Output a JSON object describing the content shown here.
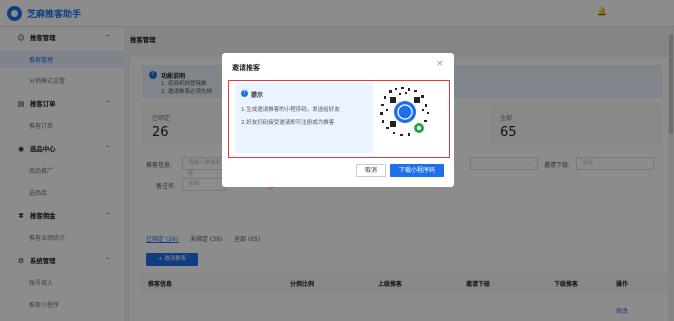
{
  "app": {
    "title": "芝麻推客助手"
  },
  "sidebar": {
    "groups": [
      {
        "icon": "user-group-icon",
        "label": "推客管理",
        "items": [
          "推客管理",
          "分销模式设置"
        ]
      },
      {
        "icon": "list-icon",
        "label": "推客订单",
        "items": [
          "推客订单"
        ]
      },
      {
        "icon": "goods-icon",
        "label": "选品中心",
        "items": [
          "商品推广",
          "选品库"
        ]
      },
      {
        "icon": "money-icon",
        "label": "推客佣金",
        "items": [
          "推客业绩统计"
        ]
      },
      {
        "icon": "settings-icon",
        "label": "系统管理",
        "items": [
          "账号接入",
          "推客小程序"
        ]
      }
    ]
  },
  "main": {
    "breadcrumb": "推客管理",
    "notice": {
      "title": "功能说明",
      "lines": [
        "1. 招商机构管辖推",
        "2. 邀请推客必须先绑"
      ]
    },
    "stats": [
      {
        "label": "已绑定",
        "value": "26"
      },
      {
        "label": "全部",
        "value": "65"
      }
    ],
    "filters": {
      "info_label": "推客信息:",
      "info_placeholder": "请输入推客昵称",
      "name_label": "备注名:",
      "name_placeholder": "全部",
      "downline_label": "邀请下级:",
      "downline_value": "全部"
    },
    "tabs": [
      "已绑定 (26)",
      "未绑定 (39)",
      "全部 (65)"
    ],
    "invite_button": "+ 邀请推客",
    "table_headers": [
      "推客信息",
      "分佣比例",
      "上级推客",
      "邀请下级",
      "下级推客",
      "操作"
    ],
    "edit_link": "修改"
  },
  "modal": {
    "title": "邀请推客",
    "tip_title": "提示",
    "tip_lines": [
      "1.生成邀请推客的小程序码，发送给好友",
      "2.好友扫码接受邀请即可注册成为推客"
    ],
    "cancel": "取消",
    "download": "下载小程序码"
  },
  "colors": {
    "primary": "#1f6feb",
    "highlight": "#e23b3b"
  }
}
